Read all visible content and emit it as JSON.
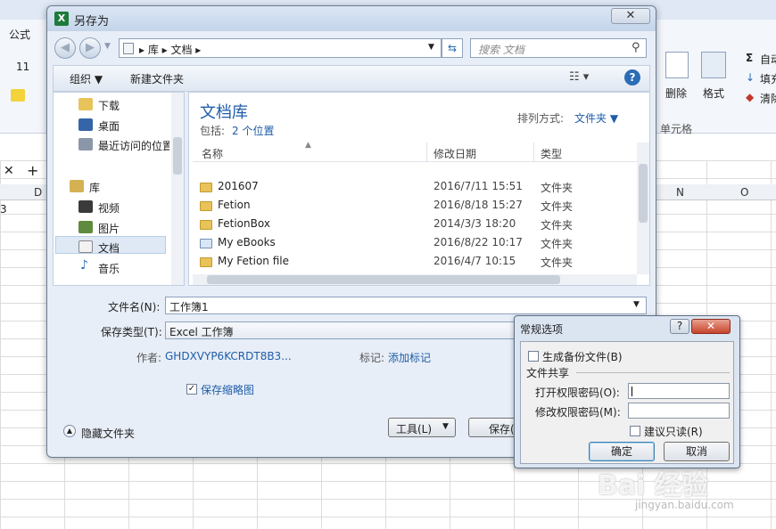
{
  "excel": {
    "tab_formula": "公式",
    "font_size": "11",
    "delete_label": "删除",
    "format_label": "格式",
    "cells_group": "单元格",
    "autosum_label": "自动",
    "fill_label": "填充",
    "clear_label": "清除",
    "columns": [
      "D",
      "N",
      "O"
    ],
    "row_number": "3"
  },
  "save_dialog": {
    "title": "另存为",
    "close": "✕",
    "address": "▸ 库 ▸ 文档 ▸",
    "search_placeholder": "搜索 文档",
    "toolbar": {
      "organize": "组织 ▼",
      "new_folder": "新建文件夹"
    },
    "nav_items": [
      {
        "label": "下载"
      },
      {
        "label": "桌面"
      },
      {
        "label": "最近访问的位置"
      },
      {
        "label": "库"
      },
      {
        "label": "视频"
      },
      {
        "label": "图片"
      },
      {
        "label": "文档"
      },
      {
        "label": "音乐"
      }
    ],
    "library_title": "文档库",
    "library_includes": "包括:",
    "library_locations": "2 个位置",
    "sort_label": "排列方式:",
    "sort_value": "文件夹 ▼",
    "columns": {
      "name": "名称",
      "date": "修改日期",
      "type": "类型"
    },
    "files": [
      {
        "name": "201607",
        "date": "2016/7/11 15:51",
        "type": "文件夹"
      },
      {
        "name": "Fetion",
        "date": "2016/8/18 15:27",
        "type": "文件夹"
      },
      {
        "name": "FetionBox",
        "date": "2014/3/3 18:20",
        "type": "文件夹"
      },
      {
        "name": "My eBooks",
        "date": "2016/8/22 10:17",
        "type": "文件夹"
      },
      {
        "name": "My Fetion file",
        "date": "2016/4/7 10:15",
        "type": "文件夹"
      }
    ],
    "filename_label": "文件名(N):",
    "filename_value": "工作簿1",
    "filetype_label": "保存类型(T):",
    "filetype_value": "Excel 工作簿",
    "author_label": "作者:",
    "author_value": "GHDXVYP6KCRDT8B3...",
    "tags_label": "标记:",
    "tags_value": "添加标记",
    "thumbnail_label": "保存缩略图",
    "hide_folders": "隐藏文件夹",
    "tools_button": "工具(L)",
    "save_button": "保存(S)"
  },
  "options_dialog": {
    "title": "常规选项",
    "help": "?",
    "close": "✕",
    "backup_label": "生成备份文件(B)",
    "share_group": "文件共享",
    "open_pwd_label": "打开权限密码(O):",
    "modify_pwd_label": "修改权限密码(M):",
    "readonly_label": "建议只读(R)",
    "ok_button": "确定",
    "cancel_button": "取消"
  },
  "watermark": {
    "main": "Bai 经验",
    "sub": "jingyan.baidu.com"
  }
}
